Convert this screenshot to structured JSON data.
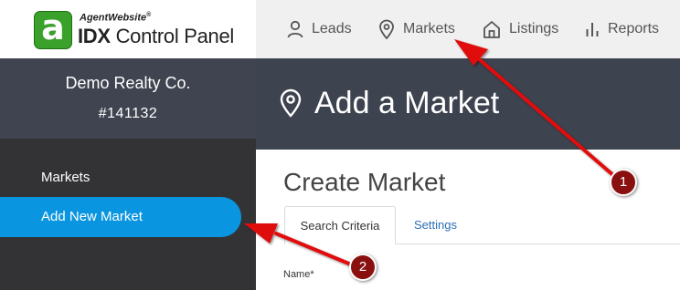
{
  "logo": {
    "mark": "a",
    "top_line": "AgentWebsite",
    "registered": "®",
    "idx": "IDX",
    "product": " Control Panel"
  },
  "company": {
    "name": "Demo Realty Co.",
    "id": "#141132"
  },
  "sidebar": {
    "items": [
      {
        "label": "Markets"
      },
      {
        "label": "Add New Market"
      }
    ]
  },
  "topnav": {
    "items": [
      {
        "label": "Leads",
        "icon": "person-icon"
      },
      {
        "label": "Markets",
        "icon": "map-pin-icon"
      },
      {
        "label": "Listings",
        "icon": "house-icon"
      },
      {
        "label": "Reports",
        "icon": "bar-chart-icon"
      }
    ]
  },
  "header": {
    "title": "Add a Market",
    "icon": "map-pin-icon"
  },
  "main": {
    "title": "Create Market",
    "tabs": [
      {
        "label": "Search Criteria"
      },
      {
        "label": "Settings"
      }
    ],
    "fields": {
      "name_label": "Name*"
    }
  },
  "annotations": [
    {
      "label": "1"
    },
    {
      "label": "2"
    }
  ],
  "colors": {
    "accent": "#0a95e0",
    "sidebar": "#333336",
    "header": "#3e4350",
    "annotation_red": "#e01010",
    "logo_green": "#3aa12b"
  }
}
